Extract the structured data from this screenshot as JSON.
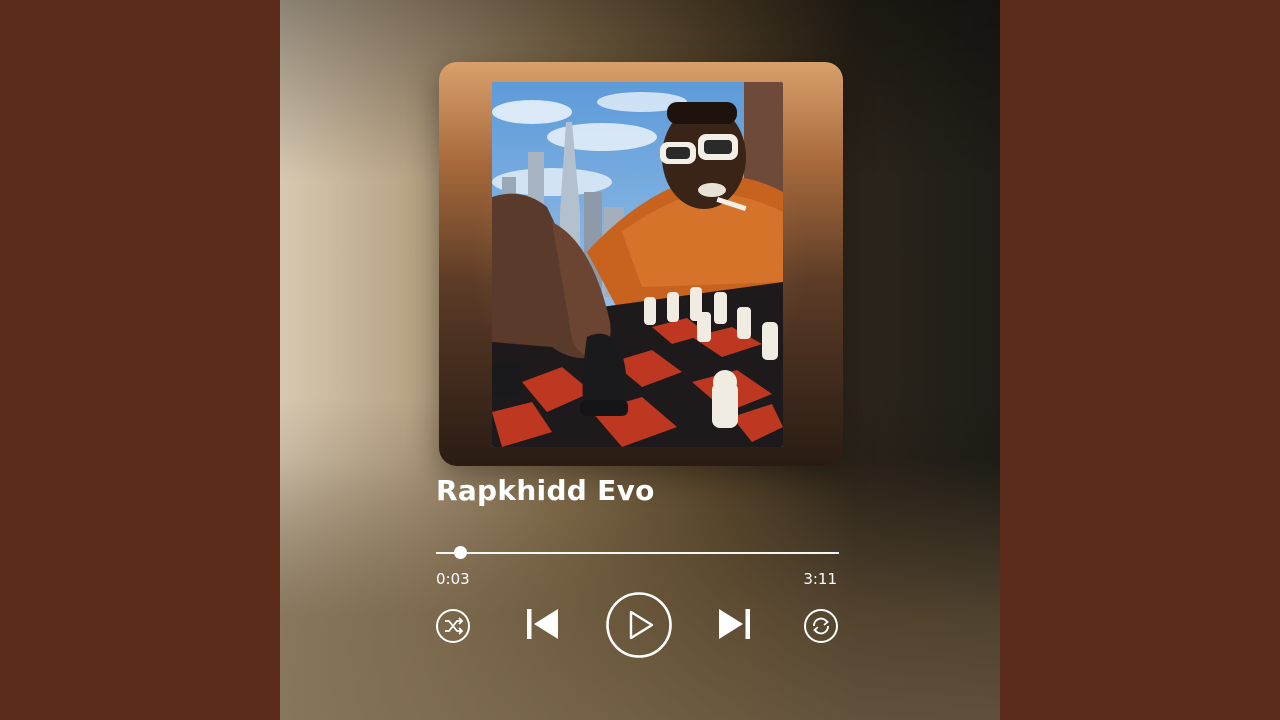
{
  "player": {
    "track_title": "Rapkhidd Evo",
    "current_time": "0:03",
    "total_time": "3:11",
    "progress": 0.016
  },
  "controls": {
    "shuffle": "shuffle-icon",
    "previous": "skip-previous-icon",
    "play": "play-icon",
    "next": "skip-next-icon",
    "repeat": "repeat-icon"
  },
  "colors": {
    "side_background": "#5a2a1b",
    "foreground": "#ffffff"
  }
}
